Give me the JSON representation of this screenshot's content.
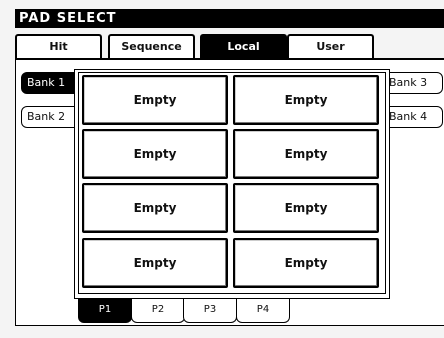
{
  "title": "PAD SELECT",
  "top_tabs": [
    {
      "label": "Hit",
      "active": false
    },
    {
      "label": "Sequence",
      "active": false
    },
    {
      "label": "Local",
      "active": true
    },
    {
      "label": "User",
      "active": false
    }
  ],
  "banks_left": [
    {
      "label": "Bank 1",
      "active": true
    },
    {
      "label": "Bank 2",
      "active": false
    }
  ],
  "banks_right": [
    {
      "label": "Bank 3",
      "active": false
    },
    {
      "label": "Bank 4",
      "active": false
    }
  ],
  "pads": [
    {
      "label": "Empty"
    },
    {
      "label": "Empty"
    },
    {
      "label": "Empty"
    },
    {
      "label": "Empty"
    },
    {
      "label": "Empty"
    },
    {
      "label": "Empty"
    },
    {
      "label": "Empty"
    },
    {
      "label": "Empty"
    }
  ],
  "pages": [
    {
      "label": "P1",
      "active": true
    },
    {
      "label": "P2",
      "active": false
    },
    {
      "label": "P3",
      "active": false
    },
    {
      "label": "P4",
      "active": false
    }
  ]
}
